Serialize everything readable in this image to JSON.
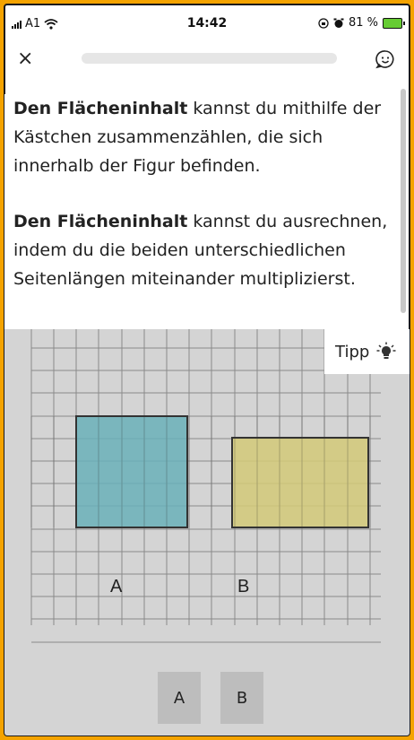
{
  "status_bar": {
    "carrier": "A1",
    "time": "14:42",
    "battery": "81 %",
    "icons": [
      "signal-icon",
      "wifi-icon",
      "orientation-lock-icon",
      "alarm-icon",
      "battery-charging-icon"
    ]
  },
  "top_bar": {
    "close_label": "×",
    "progress": 0,
    "icons": [
      "close-icon",
      "smiley-feedback-icon"
    ]
  },
  "text": {
    "para1_bold": "Den Flächeninhalt",
    "para1_rest": " kannst du mithilfe der Kästchen zusammenzählen, die sich innerhalb der Figur befinden.",
    "para2_bold": "Den Flächeninhalt",
    "para2_rest": " kannst du ausrechnen, indem du die beiden unterschiedlichen Seitenlängen miteinander multiplizierst."
  },
  "tip": {
    "label": "Tipp",
    "icon": "lightbulb-icon"
  },
  "figures": {
    "label_a": "A",
    "label_b": "B",
    "color_a": "#6ab0b8",
    "color_b": "#d2c978",
    "grid_color": "#8a8a8a",
    "outline_color": "#333333"
  },
  "answers": {
    "a": "A",
    "b": "B"
  },
  "colors": {
    "frame": "#f4a300",
    "work_bg": "#d4d4d4",
    "button_bg": "#bdbdbd"
  }
}
